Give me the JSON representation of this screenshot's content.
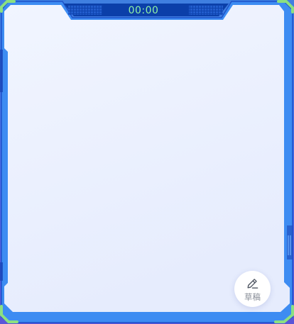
{
  "timer": {
    "text": "00:00"
  },
  "draft_button": {
    "label": "草稿",
    "icon": "pencil-icon"
  },
  "colors": {
    "frame_blue": "#3d8cf2",
    "frame_dark": "#1d52c9",
    "corner_green": "#8be081",
    "timer_text": "#8ff0a6",
    "timer_bg": "#0b3fa9",
    "panel": "#edf2fe"
  }
}
